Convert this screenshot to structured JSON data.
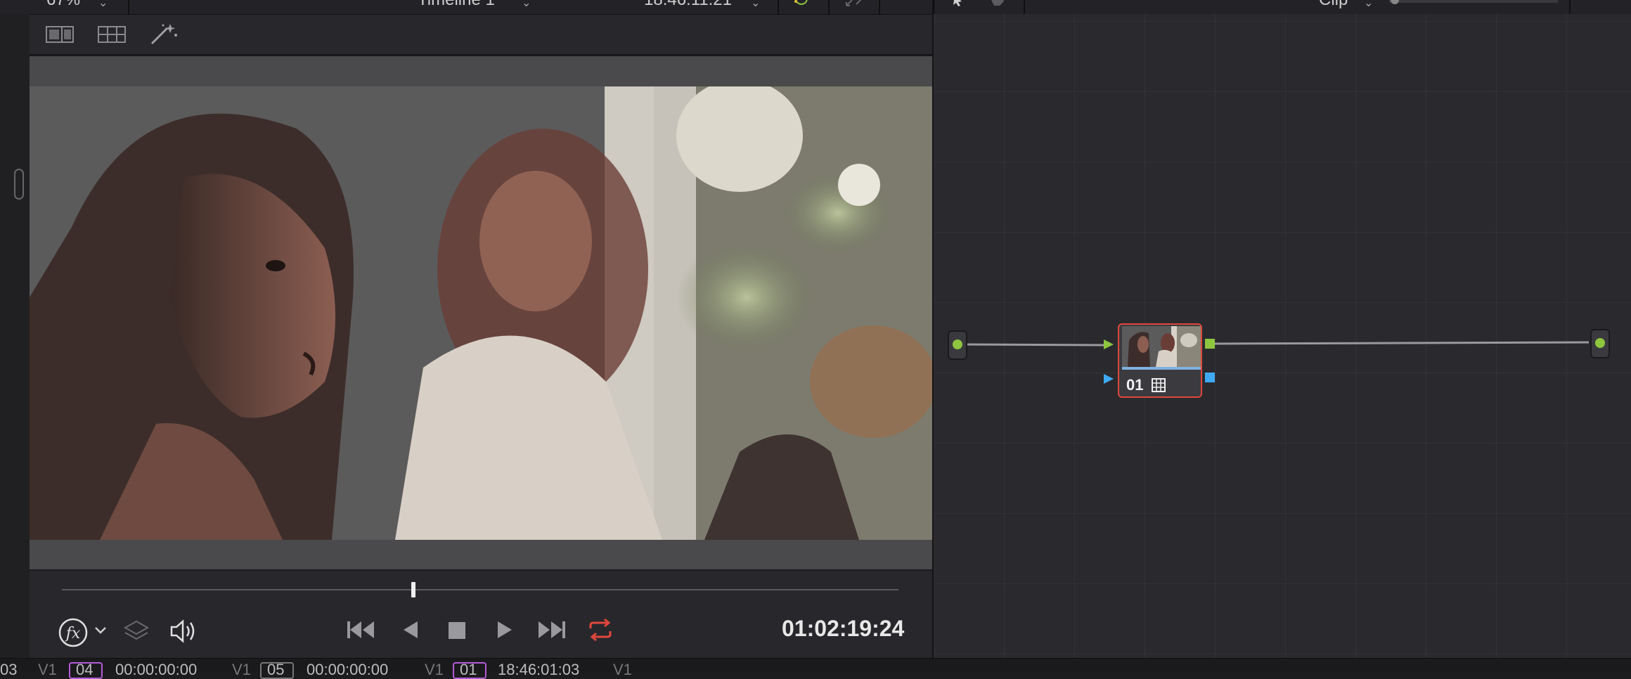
{
  "topbar": {
    "zoom": "67%",
    "timeline_name": "Timeline 1",
    "source_timecode": "18:46:11:21",
    "node_mode": "Clip"
  },
  "viewer": {
    "timecode": "01:02:19:24",
    "playhead_fraction": 0.42
  },
  "node_editor": {
    "node_label": "01"
  },
  "bottom_clips": [
    {
      "index": "04",
      "timecode": "00:00:00:00",
      "track": "V1"
    },
    {
      "index": "05",
      "timecode": "00:00:00:00",
      "track": "V1"
    },
    {
      "index": "01",
      "timecode": "18:46:01:03",
      "track": "V1"
    }
  ],
  "icons": {
    "toolbar": [
      "split-view-icon",
      "grid-view-icon",
      "magic-wand-icon"
    ],
    "transport": [
      "fx-icon",
      "layers-icon",
      "volume-icon",
      "jump-start-icon",
      "play-reverse-icon",
      "stop-icon",
      "play-icon",
      "jump-end-icon",
      "loop-icon"
    ]
  },
  "colors": {
    "accent_red": "#e0473c",
    "node_green": "#8ec63f",
    "node_blue": "#3fa9f5",
    "clip_purple": "#b45bd6"
  }
}
